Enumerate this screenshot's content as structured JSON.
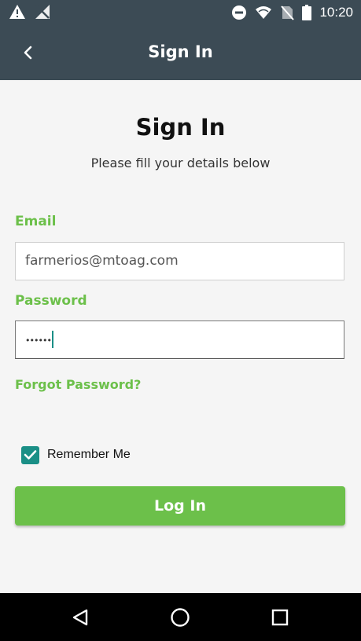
{
  "status_bar": {
    "time": "10:20",
    "icons": [
      "warning-icon",
      "no-signal-icon",
      "do-not-disturb-icon",
      "wifi-icon",
      "no-sim-icon",
      "battery-icon"
    ]
  },
  "app_bar": {
    "title": "Sign In",
    "back_icon": "chevron-left-icon"
  },
  "header": {
    "title": "Sign In",
    "subtitle": "Please fill your details below"
  },
  "form": {
    "email": {
      "label": "Email",
      "value": "farmerios@mtoag.com"
    },
    "password": {
      "label": "Password",
      "value": "••••••"
    },
    "forgot_password": "Forgot Password?",
    "remember_me": {
      "label": "Remember Me",
      "checked": true
    },
    "login_label": "Log In"
  },
  "colors": {
    "app_bar": "#3c4b55",
    "accent_green": "#6cc04a",
    "teal": "#1a8f86",
    "background": "#f5f5f5"
  },
  "nav_bar": {
    "icons": [
      "back-triangle-icon",
      "home-circle-icon",
      "recents-square-icon"
    ]
  }
}
